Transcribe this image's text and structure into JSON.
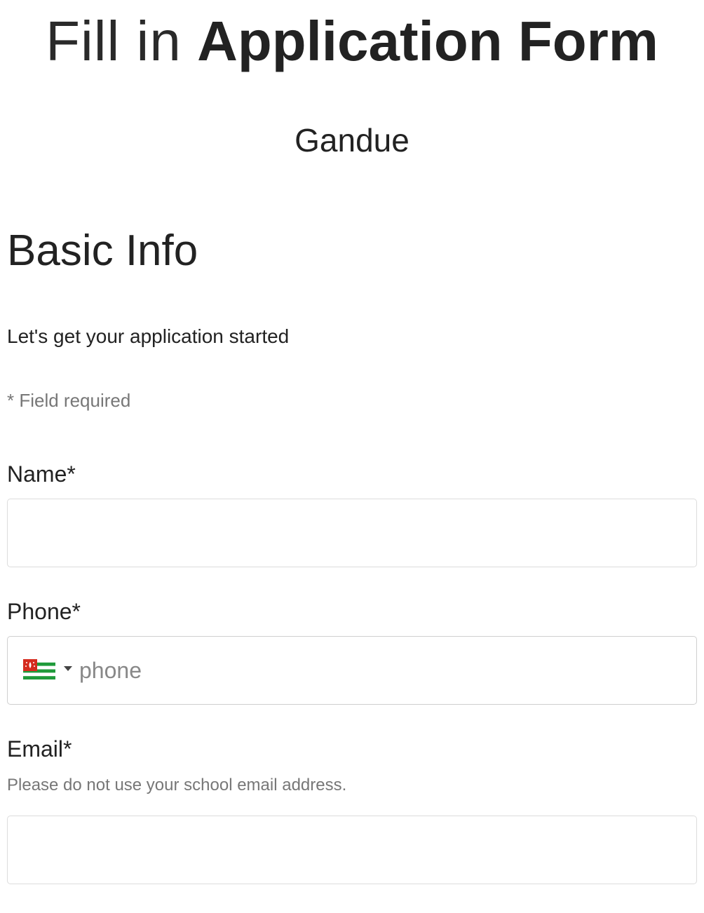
{
  "header": {
    "title_light": "Fill in",
    "title_bold": "Application Form",
    "organization": "Gandue"
  },
  "section": {
    "title": "Basic Info",
    "intro": "Let's get your application started",
    "required_note": "* Field required"
  },
  "fields": {
    "name": {
      "label": "Name*",
      "value": "",
      "placeholder": ""
    },
    "phone": {
      "label": "Phone*",
      "value": "",
      "placeholder": "phone",
      "country_flag_icon": "abkhazia-flag-icon"
    },
    "email": {
      "label": "Email*",
      "hint": "Please do not use your school email address.",
      "value": "",
      "placeholder": ""
    }
  },
  "colors": {
    "text": "#222222",
    "muted": "#777777",
    "border": "#dcdcdc",
    "flag_green": "#1f9a3a",
    "flag_red": "#d52b1e"
  }
}
